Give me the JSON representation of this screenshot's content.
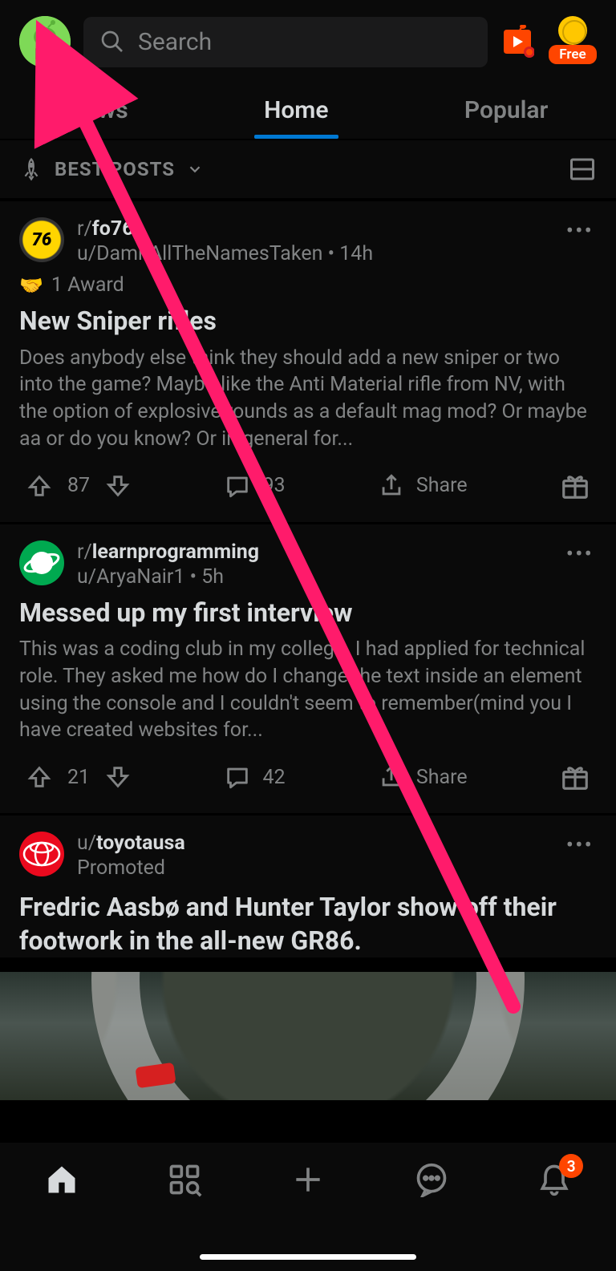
{
  "header": {
    "search_placeholder": "Search",
    "free_label": "Free"
  },
  "tabs": [
    {
      "label": "News",
      "active": false
    },
    {
      "label": "Home",
      "active": true
    },
    {
      "label": "Popular",
      "active": false
    }
  ],
  "sort": {
    "label": "BEST POSTS"
  },
  "posts": [
    {
      "subreddit_prefix": "r/",
      "subreddit": "fo76",
      "author_prefix": "u/",
      "author": "DamnAllTheNamesTaken",
      "sep": " • ",
      "age": "14h",
      "awards": "1 Award",
      "title": "New Sniper rifles",
      "body": "Does anybody else think they should add a new sniper or two into the game? Maybe like the Anti Material rifle from NV, with the option of explosive rounds as a default mag mod? Or maybe aa or do you know? Or in general for...",
      "upvotes": "87",
      "comments": "93",
      "share": "Share"
    },
    {
      "subreddit_prefix": "r/",
      "subreddit": "learnprogramming",
      "author_prefix": "u/",
      "author": "AryaNair1",
      "sep": " • ",
      "age": "5h",
      "title": "Messed up my first interview",
      "body": "This was a coding club in my college. I had applied for technical role. They asked me how do I change the text inside an element using the console and I couldn't seem to remember(mind you I have created websites for...",
      "upvotes": "21",
      "comments": "42",
      "share": "Share"
    },
    {
      "author_prefix": "u/",
      "author": "toyotausa",
      "promoted": "Promoted",
      "title": "Fredric Aasbø and Hunter Taylor show off their footwork in the all-new GR86."
    }
  ],
  "bottom_nav": {
    "notifications_count": "3"
  }
}
